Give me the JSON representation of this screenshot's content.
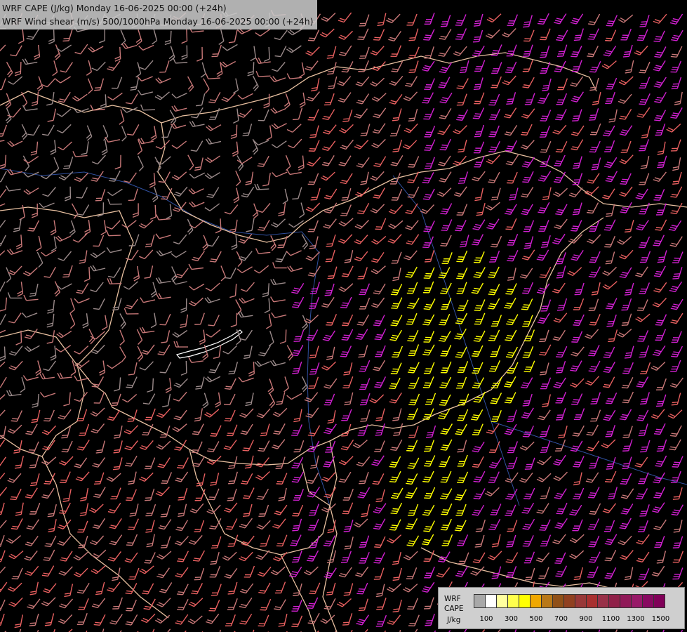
{
  "titles": [
    "WRF CAPE (J/kg) Monday 16-06-2025 00:00 (+24h)",
    "WRF Wind shear (m/s) 500/1000hPa Monday 16-06-2025 00:00 (+24h)"
  ],
  "legend": {
    "label_lines": [
      "WRF",
      "CAPE",
      "J/kg"
    ],
    "colors": [
      "#a8a8a8",
      "#ffffff",
      "#ffff9e",
      "#ffff4c",
      "#ffff00",
      "#f0a800",
      "#b87818",
      "#905018",
      "#904020",
      "#983838",
      "#a83030",
      "#983048",
      "#902048",
      "#901858",
      "#981868",
      "#880860",
      "#800058"
    ],
    "ticks": [
      "100",
      "300",
      "500",
      "700",
      "900",
      "1100",
      "1300",
      "1500"
    ]
  },
  "colors": {
    "background": "#000000",
    "barb_low": "#c87878",
    "barb_grey": "#9a8a8a",
    "barb_mid": "#e86060",
    "barb_high": "#d020d0",
    "barb_cape": "#ffff00",
    "border": "#e8c0a0",
    "river": "#3050a0"
  }
}
